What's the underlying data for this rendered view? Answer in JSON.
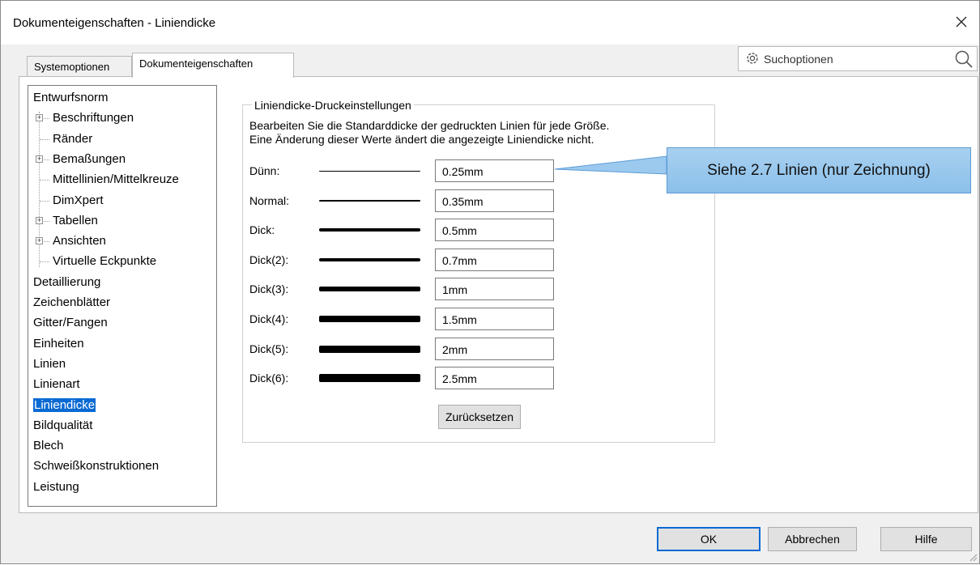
{
  "window": {
    "title": "Dokumenteigenschaften - Liniendicke"
  },
  "tabs": [
    {
      "label": "Systemoptionen",
      "active": false
    },
    {
      "label": "Dokumenteigenschaften",
      "active": true
    }
  ],
  "search": {
    "label": "Suchoptionen",
    "icon_left": "gear-icon",
    "icon_right": "search-icon"
  },
  "tree": {
    "items": [
      {
        "label": "Entwurfsnorm"
      },
      {
        "label": "Beschriftungen",
        "expandable": true
      },
      {
        "label": "Ränder"
      },
      {
        "label": "Bemaßungen",
        "expandable": true
      },
      {
        "label": "Mittellinien/Mittelkreuze"
      },
      {
        "label": "DimXpert"
      },
      {
        "label": "Tabellen",
        "expandable": true
      },
      {
        "label": "Ansichten",
        "expandable": true
      },
      {
        "label": "Virtuelle Eckpunkte"
      },
      {
        "label": "Detaillierung"
      },
      {
        "label": "Zeichenblätter"
      },
      {
        "label": "Gitter/Fangen"
      },
      {
        "label": "Einheiten"
      },
      {
        "label": "Linien"
      },
      {
        "label": "Linienart"
      },
      {
        "label": "Liniendicke",
        "selected": true
      },
      {
        "label": "Bildqualität"
      },
      {
        "label": "Blech"
      },
      {
        "label": "Schweißkonstruktionen"
      },
      {
        "label": "Leistung"
      }
    ]
  },
  "group": {
    "title": "Liniendicke-Druckeinstellungen",
    "desc1": "Bearbeiten Sie die Standarddicke der gedruckten Linien für jede Größe.",
    "desc2": "Eine Änderung dieser Werte ändert die angezeigte Liniendicke nicht."
  },
  "rows": [
    {
      "label": "Dünn:",
      "value": "0.25mm"
    },
    {
      "label": "Normal:",
      "value": "0.35mm"
    },
    {
      "label": "Dick:",
      "value": "0.5mm"
    },
    {
      "label": "Dick(2):",
      "value": "0.7mm"
    },
    {
      "label": "Dick(3):",
      "value": "1mm"
    },
    {
      "label": "Dick(4):",
      "value": "1.5mm"
    },
    {
      "label": "Dick(5):",
      "value": "2mm"
    },
    {
      "label": "Dick(6):",
      "value": "2.5mm"
    }
  ],
  "reset_label": "Zurücksetzen",
  "callout": "Siehe 2.7 Linien (nur Zeichnung)",
  "buttons": {
    "ok": "OK",
    "cancel": "Abbrechen",
    "help": "Hilfe"
  },
  "colors": {
    "selection": "#0a6ad3",
    "callout": "#9ccaef"
  }
}
